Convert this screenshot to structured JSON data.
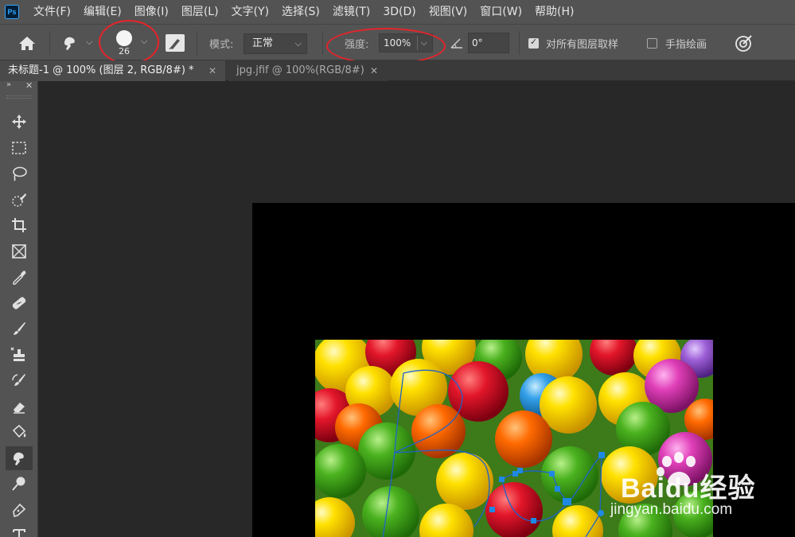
{
  "app": {
    "logo_text": "Ps"
  },
  "menu": [
    "文件(F)",
    "编辑(E)",
    "图像(I)",
    "图层(L)",
    "文字(Y)",
    "选择(S)",
    "滤镜(T)",
    "3D(D)",
    "视图(V)",
    "窗口(W)",
    "帮助(H)"
  ],
  "options": {
    "brush_size": "26",
    "mode_label": "模式:",
    "mode_value": "正常",
    "strength_label": "强度:",
    "strength_value": "100%",
    "angle_value": "0°",
    "sample_all_layers_label": "对所有图层取样",
    "sample_all_layers_checked": true,
    "finger_painting_label": "手指绘画",
    "finger_painting_checked": false
  },
  "tabs": [
    {
      "label": "未标题-1 @ 100% (图层 2, RGB/8#) *",
      "active": true
    },
    {
      "label": "jpg.jfif @ 100%(RGB/8#)",
      "active": false
    }
  ],
  "toolbar": {
    "tools": [
      "move-tool",
      "marquee-tool",
      "lasso-tool",
      "quick-selection-tool",
      "crop-tool",
      "frame-tool",
      "eyedropper-tool",
      "healing-brush-tool",
      "brush-tool",
      "clone-stamp-tool",
      "history-brush-tool",
      "eraser-tool",
      "paint-bucket-tool",
      "smudge-tool",
      "dodge-tool",
      "pen-tool",
      "type-tool"
    ],
    "selected": "smudge-tool"
  },
  "watermark": {
    "brand": "Baidu经验",
    "url": "jingyan.baidu.com"
  },
  "colors": {
    "highlight_red": "#e8232a",
    "path_blue": "#1e88e5",
    "ui_gray": "#535353",
    "canvas": "#000000"
  }
}
